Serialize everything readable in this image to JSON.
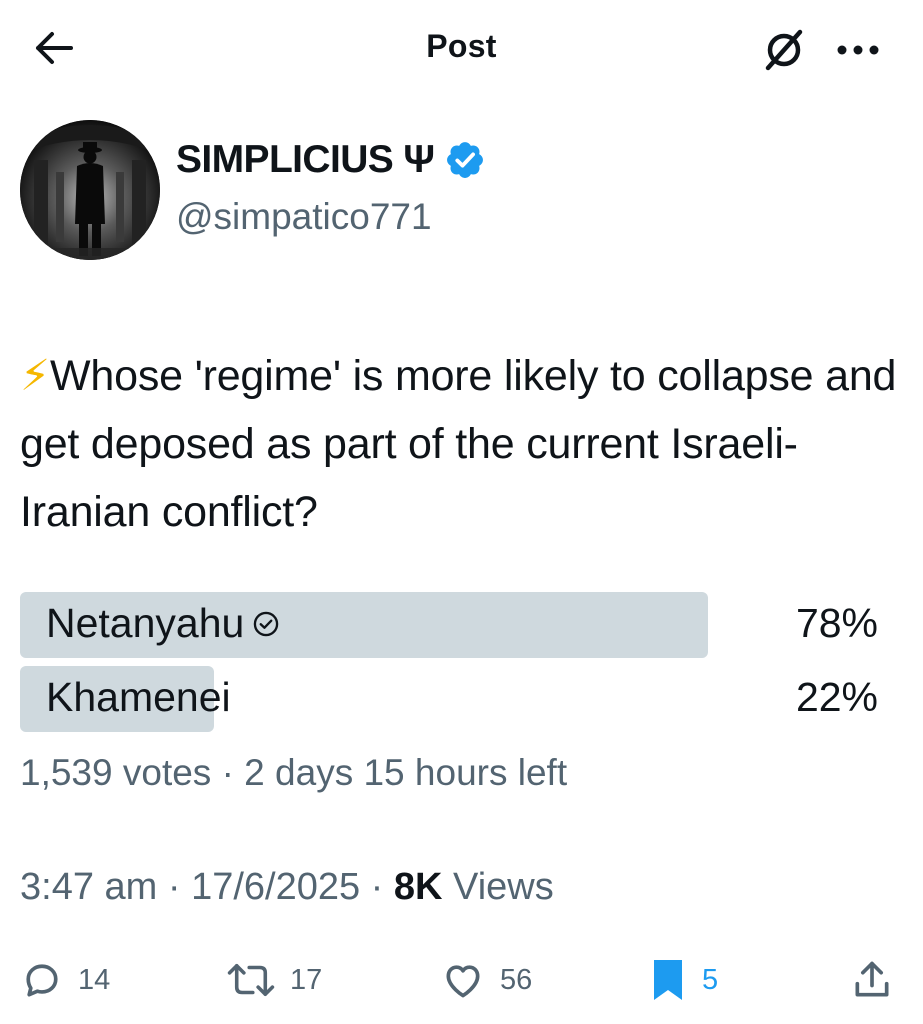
{
  "header": {
    "title": "Post",
    "back_icon": "arrow-left-icon",
    "grok_icon": "slash-circle-icon",
    "more_icon": "more-horizontal-icon"
  },
  "author": {
    "name": "SIMPLICIUS Ψ",
    "handle": "@simpatico771",
    "verified": true,
    "verified_color": "#1d9bf0"
  },
  "tweet": {
    "emoji": "⚡",
    "text": "Whose 'regime' is more likely to collapse and get deposed as part of the current Israeli-Iranian conflict?"
  },
  "poll": {
    "options": [
      {
        "label": "Netanyahu",
        "percent": "78%",
        "share": 0.78,
        "selected": true
      },
      {
        "label": "Khamenei",
        "percent": "22%",
        "share": 0.22,
        "selected": false
      }
    ],
    "meta": "1,539 votes · 2 days 15 hours left",
    "bar_color": "#cfd9de"
  },
  "timestamp": {
    "time_date": "3:47 am · 17/6/2025 · ",
    "views_count": "8K",
    "views_label": " Views"
  },
  "actions": {
    "replies": "14",
    "reposts": "17",
    "likes": "56",
    "bookmarks": "5",
    "bookmark_color": "#1d9bf0"
  }
}
